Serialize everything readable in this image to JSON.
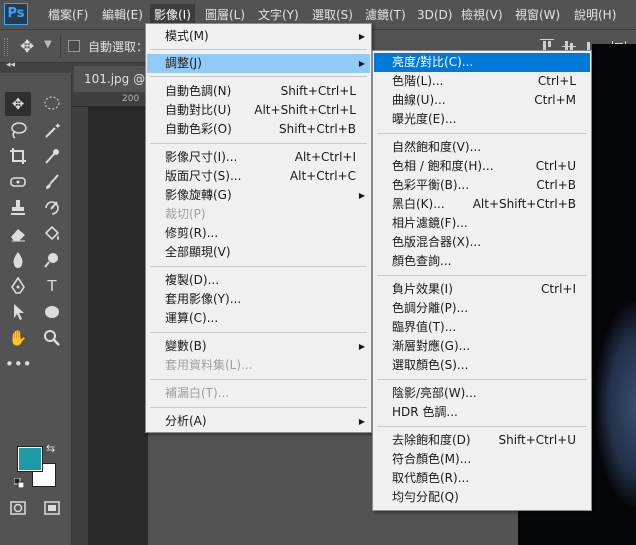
{
  "app": {
    "logo": "Ps"
  },
  "menubar": {
    "items": [
      {
        "label": "檔案(F)"
      },
      {
        "label": "編輯(E)"
      },
      {
        "label": "影像(I)"
      },
      {
        "label": "圖層(L)"
      },
      {
        "label": "文字(Y)"
      },
      {
        "label": "選取(S)"
      },
      {
        "label": "濾鏡(T)"
      },
      {
        "label": "3D(D)"
      },
      {
        "label": "檢視(V)"
      },
      {
        "label": "視窗(W)"
      },
      {
        "label": "說明(H)"
      }
    ]
  },
  "options": {
    "auto_select": "自動選取："
  },
  "document": {
    "tab": "101.jpg @ 3",
    "ruler_label": "200"
  },
  "colors": {
    "foreground": "#1a9ba6",
    "background": "#ffffff",
    "highlight": "#91c9f7",
    "selected_item": "#0078d7"
  },
  "image_menu": {
    "items": [
      {
        "label": "模式(M)",
        "shortcut": "",
        "submenu": true
      },
      {
        "label": "調整(J)",
        "shortcut": "",
        "submenu": true
      },
      {
        "label": "自動色調(N)",
        "shortcut": "Shift+Ctrl+L"
      },
      {
        "label": "自動對比(U)",
        "shortcut": "Alt+Shift+Ctrl+L"
      },
      {
        "label": "自動色彩(O)",
        "shortcut": "Shift+Ctrl+B"
      },
      {
        "label": "影像尺寸(I)...",
        "shortcut": "Alt+Ctrl+I"
      },
      {
        "label": "版面尺寸(S)...",
        "shortcut": "Alt+Ctrl+C"
      },
      {
        "label": "影像旋轉(G)",
        "shortcut": "",
        "submenu": true
      },
      {
        "label": "裁切(P)",
        "shortcut": "",
        "disabled": true
      },
      {
        "label": "修剪(R)...",
        "shortcut": ""
      },
      {
        "label": "全部顯現(V)",
        "shortcut": ""
      },
      {
        "label": "複製(D)...",
        "shortcut": ""
      },
      {
        "label": "套用影像(Y)...",
        "shortcut": ""
      },
      {
        "label": "運算(C)...",
        "shortcut": ""
      },
      {
        "label": "變數(B)",
        "shortcut": "",
        "submenu": true
      },
      {
        "label": "套用資料集(L)...",
        "shortcut": "",
        "disabled": true
      },
      {
        "label": "補漏白(T)...",
        "shortcut": "",
        "disabled": true
      },
      {
        "label": "分析(A)",
        "shortcut": "",
        "submenu": true
      }
    ]
  },
  "adjust_menu": {
    "items": [
      {
        "label": "亮度/對比(C)...",
        "shortcut": ""
      },
      {
        "label": "色階(L)...",
        "shortcut": "Ctrl+L"
      },
      {
        "label": "曲線(U)...",
        "shortcut": "Ctrl+M"
      },
      {
        "label": "曝光度(E)...",
        "shortcut": ""
      },
      {
        "label": "自然飽和度(V)...",
        "shortcut": ""
      },
      {
        "label": "色相 / 飽和度(H)...",
        "shortcut": "Ctrl+U"
      },
      {
        "label": "色彩平衡(B)...",
        "shortcut": "Ctrl+B"
      },
      {
        "label": "黑白(K)...",
        "shortcut": "Alt+Shift+Ctrl+B"
      },
      {
        "label": "相片濾鏡(F)...",
        "shortcut": ""
      },
      {
        "label": "色版混合器(X)...",
        "shortcut": ""
      },
      {
        "label": "顏色查詢...",
        "shortcut": ""
      },
      {
        "label": "負片效果(I)",
        "shortcut": "Ctrl+I"
      },
      {
        "label": "色調分離(P)...",
        "shortcut": ""
      },
      {
        "label": "臨界值(T)...",
        "shortcut": ""
      },
      {
        "label": "漸層對應(G)...",
        "shortcut": ""
      },
      {
        "label": "選取顏色(S)...",
        "shortcut": ""
      },
      {
        "label": "陰影/亮部(W)...",
        "shortcut": ""
      },
      {
        "label": "HDR 色調...",
        "shortcut": ""
      },
      {
        "label": "去除飽和度(D)",
        "shortcut": "Shift+Ctrl+U"
      },
      {
        "label": "符合顏色(M)...",
        "shortcut": ""
      },
      {
        "label": "取代顏色(R)...",
        "shortcut": ""
      },
      {
        "label": "均勻分配(Q)",
        "shortcut": ""
      }
    ]
  }
}
